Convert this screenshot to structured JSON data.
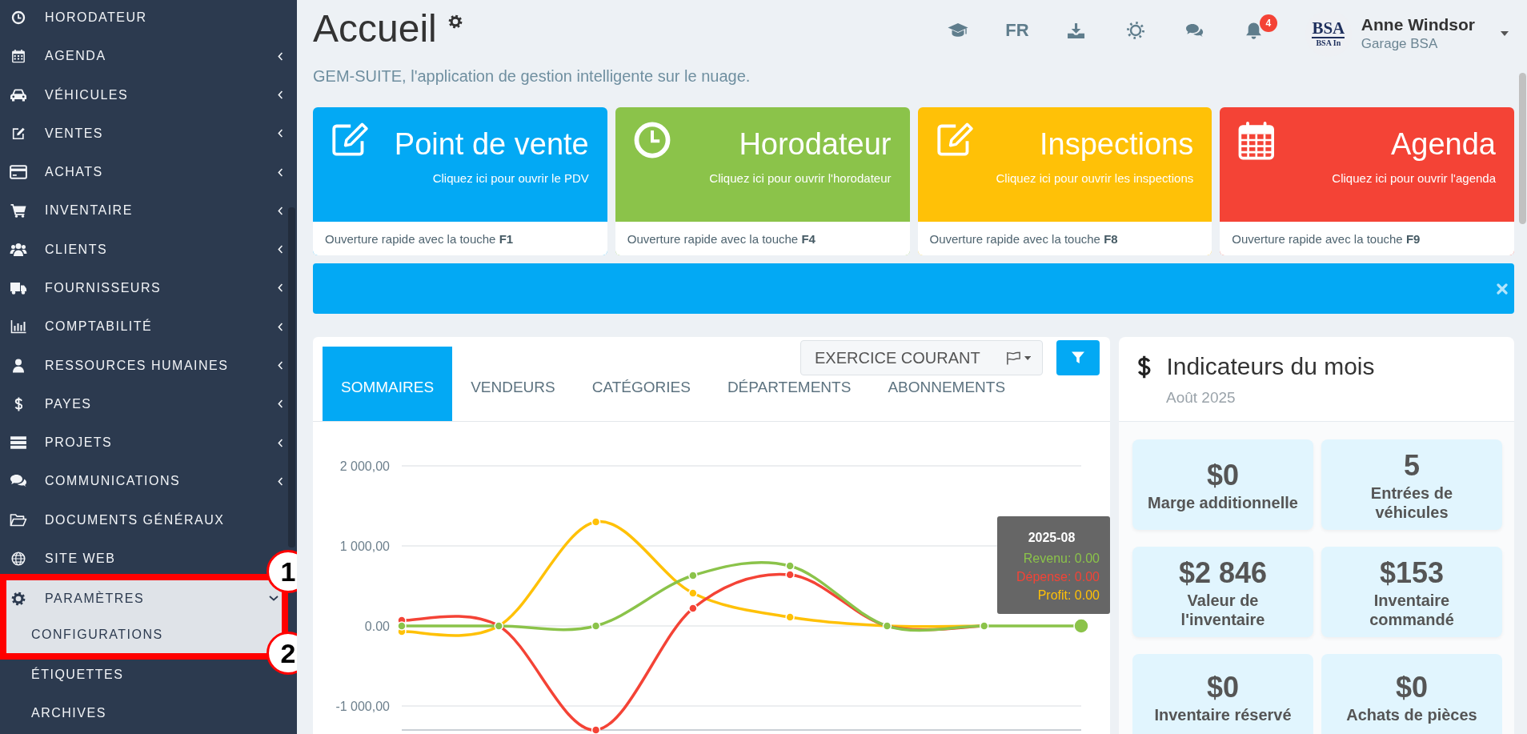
{
  "sidebar": {
    "items": [
      {
        "label": "HORODATEUR",
        "kind": "link",
        "selected": false
      },
      {
        "label": "AGENDA",
        "kind": "group",
        "expanded": false,
        "selected": false
      },
      {
        "label": "VÉHICULES",
        "kind": "group",
        "expanded": false,
        "selected": false
      },
      {
        "label": "VENTES",
        "kind": "group",
        "expanded": false,
        "selected": false
      },
      {
        "label": "ACHATS",
        "kind": "group",
        "expanded": false,
        "selected": false
      },
      {
        "label": "INVENTAIRE",
        "kind": "group",
        "expanded": false,
        "selected": false
      },
      {
        "label": "CLIENTS",
        "kind": "group",
        "expanded": false,
        "selected": false
      },
      {
        "label": "FOURNISSEURS",
        "kind": "group",
        "expanded": false,
        "selected": false
      },
      {
        "label": "COMPTABILITÉ",
        "kind": "group",
        "expanded": false,
        "selected": false
      },
      {
        "label": "RESSOURCES HUMAINES",
        "kind": "group",
        "expanded": false,
        "selected": false
      },
      {
        "label": "PAYES",
        "kind": "group",
        "expanded": false,
        "selected": false
      },
      {
        "label": "PROJETS",
        "kind": "group",
        "expanded": false,
        "selected": false
      },
      {
        "label": "COMMUNICATIONS",
        "kind": "group",
        "expanded": false,
        "selected": false
      },
      {
        "label": "DOCUMENTS GÉNÉRAUX",
        "kind": "link",
        "selected": false
      },
      {
        "label": "SITE WEB",
        "kind": "link",
        "selected": false
      },
      {
        "label": "PARAMÈTRES",
        "kind": "group",
        "expanded": true,
        "selected": true,
        "children": [
          {
            "label": "CONFIGURATIONS",
            "selected": true
          },
          {
            "label": "ÉTIQUETTES",
            "selected": false
          },
          {
            "label": "ARCHIVES",
            "selected": false
          }
        ]
      }
    ]
  },
  "annotation": {
    "markers": [
      "1",
      "2"
    ]
  },
  "header": {
    "title": "Accueil",
    "subtitle": "GEM-SUITE, l'application de gestion intelligente sur le nuage.",
    "language": "FR",
    "notification_count": "4",
    "user": {
      "logo_text": "BSA",
      "logo_subtext": "BSA In",
      "name": "Anne Windsor",
      "company": "Garage BSA"
    }
  },
  "shortcut_tiles": [
    {
      "title": "Point de vente",
      "caption": "Cliquez ici pour ouvrir le PDV",
      "hint": "Ouverture rapide avec la touche **F1**",
      "color": "#03a9f4"
    },
    {
      "title": "Horodateur",
      "caption": "Cliquez ici pour ouvrir l'horodateur",
      "hint": "Ouverture rapide avec la touche **F4**",
      "color": "#8bc34a"
    },
    {
      "title": "Inspections",
      "caption": "Cliquez ici pour ouvrir les inspections",
      "hint": "Ouverture rapide avec la touche **F8**",
      "color": "#ffc107"
    },
    {
      "title": "Agenda",
      "caption": "Cliquez ici pour ouvrir l'agenda",
      "hint": "Ouverture rapide avec la touche **F9**",
      "color": "#f44336"
    }
  ],
  "notice_bar": {
    "closable": true
  },
  "sales_panel": {
    "tabs": [
      {
        "label": "SOMMAIRES",
        "selected": true
      },
      {
        "label": "VENDEURS",
        "selected": false
      },
      {
        "label": "CATÉGORIES",
        "selected": false
      },
      {
        "label": "DÉPARTEMENTS",
        "selected": false
      },
      {
        "label": "ABONNEMENTS",
        "selected": false
      }
    ],
    "period": "EXERCICE COURANT",
    "chart_data": {
      "type": "line",
      "grid": true,
      "ylim": [
        -1300,
        2000
      ],
      "yticks": [
        {
          "value": -1000,
          "label": "-1 000,00"
        },
        {
          "value": 0,
          "label": "0.00"
        },
        {
          "value": 1000,
          "label": "1 000,00"
        },
        {
          "value": 2000,
          "label": "2 000,00"
        }
      ],
      "series": [
        {
          "name": "Revenu",
          "color": "#8bc34a",
          "marker": true,
          "values": [
            0,
            0,
            0,
            630,
            750,
            0,
            0,
            0
          ]
        },
        {
          "name": "Dépense",
          "color": "#f44336",
          "marker": true,
          "values": [
            70,
            0,
            -1300,
            220,
            640,
            0,
            0,
            null
          ]
        },
        {
          "name": "Profit",
          "color": "#ffc107",
          "marker": true,
          "values": [
            -70,
            0,
            1300,
            410,
            110,
            0,
            0,
            null
          ]
        }
      ]
    },
    "tooltip": {
      "title": "2025-08",
      "separator": ":",
      "values": [
        "0.00",
        "0.00",
        "0.00"
      ]
    }
  },
  "indicators": {
    "title": "Indicateurs du mois",
    "period": "Août 2025",
    "cards": [
      {
        "value": "$0",
        "label": "Marge additionnelle"
      },
      {
        "value": "5",
        "label": "Entrées de véhicules"
      },
      {
        "value": "$2 846",
        "label": "Valeur de l'inventaire"
      },
      {
        "value": "$153",
        "label": "Inventaire commandé"
      },
      {
        "value": "$0",
        "label": "Inventaire réservé"
      },
      {
        "value": "$0",
        "label": "Achats de pièces"
      }
    ]
  }
}
